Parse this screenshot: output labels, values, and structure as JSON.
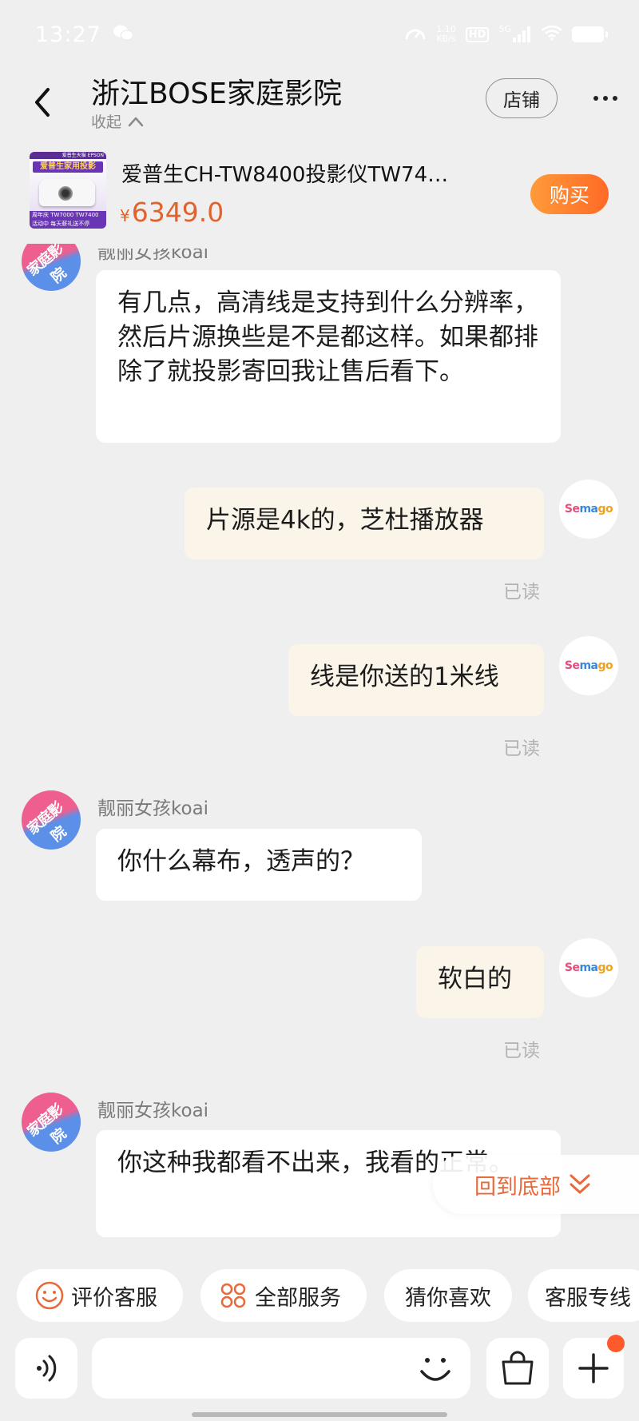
{
  "status_bar": {
    "time": "13:27",
    "speed_value": "1.10",
    "speed_unit": "KB/s",
    "hd_label": "HD",
    "network_label": "5G",
    "battery_label": ""
  },
  "header": {
    "shop_name": "浙江BOSE家庭影院",
    "collapse_label": "收起",
    "store_button": "店铺"
  },
  "product": {
    "thumb_brand": "爱普生天猫 EPSON",
    "thumb_title": "爱普生家用投影",
    "thumb_bottom_1": "周年庆 TW7000 TW7400",
    "thumb_bottom_2": "活动中 每天薪礼送不停",
    "title": "爱普生CH-TW8400投影仪TW74…",
    "price_symbol": "¥",
    "price": "6349.0",
    "buy_label": "购买"
  },
  "avatars": {
    "seller_text": "家庭影院",
    "user_text_a": "Se",
    "user_text_b": "ma",
    "user_text_c": "go"
  },
  "messages": [
    {
      "sender": "seller",
      "name": "靓丽女孩koai",
      "text": "有几点，高清线是支持到什么分辨率，然后片源换些是不是都这样。如果都排除了就投影寄回我让售后看下。"
    },
    {
      "sender": "me",
      "text": "片源是4k的，芝杜播放器",
      "status": "已读"
    },
    {
      "sender": "me",
      "text": "线是你送的1米线",
      "status": "已读"
    },
    {
      "sender": "seller",
      "name": "靓丽女孩koai",
      "text": "你什么幕布，透声的？"
    },
    {
      "sender": "me",
      "text": "软白的",
      "status": "已读"
    },
    {
      "sender": "seller",
      "name": "靓丽女孩koai",
      "text": "你这种我都看不出来，我看的正常。"
    }
  ],
  "back_to_bottom": "回到底部",
  "quick_actions": [
    {
      "label": "评价客服",
      "icon": "smile-icon"
    },
    {
      "label": "全部服务",
      "icon": "grid-icon"
    },
    {
      "label": "猜你喜欢",
      "icon": ""
    },
    {
      "label": "客服专线",
      "icon": ""
    }
  ],
  "input": {
    "placeholder": "",
    "value": ""
  },
  "colors": {
    "accent": "#e2622d",
    "buy_button": "#ff7a2e",
    "mine_bubble": "#fbf5e9",
    "page_bg": "#efefef"
  }
}
